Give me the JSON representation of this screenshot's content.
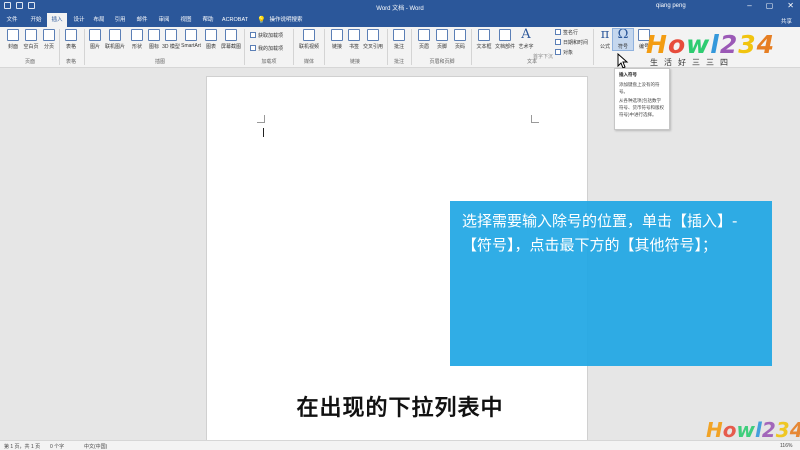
{
  "titlebar": {
    "title": "Word 文档 - Word",
    "user": "qiang peng",
    "minimize": "–",
    "restore": "▢",
    "close": "✕"
  },
  "tabs": [
    {
      "label": "文件"
    },
    {
      "label": "开始"
    },
    {
      "label": "插入",
      "active": true
    },
    {
      "label": "设计"
    },
    {
      "label": "布局"
    },
    {
      "label": "引用"
    },
    {
      "label": "邮件"
    },
    {
      "label": "审阅"
    },
    {
      "label": "视图"
    },
    {
      "label": "帮助"
    },
    {
      "label": "ACROBAT"
    },
    {
      "label": "操作说明搜索"
    }
  ],
  "share_label": "共享",
  "ribbon": {
    "buttons": {
      "cover": "封面",
      "blank_page": "空白页",
      "page_break": "分页",
      "table": "表格",
      "picture": "图片",
      "online_picture": "联机图片",
      "shapes": "形状",
      "icons": "图标",
      "model_3d": "3D 模型",
      "smartart": "SmartArt",
      "chart": "图表",
      "screenshot": "屏幕截图",
      "online_video": "联机视频",
      "link": "链接",
      "bookmark": "书签",
      "cross_ref": "交叉引用",
      "comment": "批注",
      "header": "页眉",
      "footer": "页脚",
      "page_number": "页码",
      "textbox": "文本框",
      "doc_parts": "文档部件",
      "wordart": "艺术字",
      "drop_cap": "首字下沉",
      "equation": "公式",
      "symbol": "符号",
      "numbering": "编号"
    },
    "small": {
      "get_addins": "获取加载项",
      "my_addins": "我的加载项",
      "signature_line": "签名行",
      "date_time": "日期和时间",
      "object": "对象"
    },
    "groups": {
      "pages": "页面",
      "tables": "表格",
      "illustrations": "插图",
      "addins": "加载项",
      "media": "媒体",
      "links": "链接",
      "comments": "批注",
      "header_footer": "页眉和页脚",
      "text": "文本"
    },
    "symbol_glyph": "Ω",
    "equation_glyph": "π"
  },
  "tooltip": {
    "title": "插入符号",
    "line1": "添加键盘上没有的符号。",
    "line2": "从各种选项(包括数学符号、货币符号和版权符号)中进行选择。"
  },
  "logo": {
    "word": "Howl234",
    "slogan": "生活好三三四",
    "bottom_word": "Howl234",
    "colors": [
      "#f39c12",
      "#e74c3c",
      "#2ecc71",
      "#3498db",
      "#9b59b6",
      "#f1c40f",
      "#e67e22"
    ]
  },
  "overlay": {
    "text": "选择需要输入除号的位置，单击【插入】-【符号】，点击最下方的【其他符号】；"
  },
  "subtitle": "在出现的下拉列表中",
  "statusbar": {
    "page": "第 1 页，共 1 页",
    "words": "0 个字",
    "lang": "中文(中国)",
    "zoom": "116%"
  }
}
